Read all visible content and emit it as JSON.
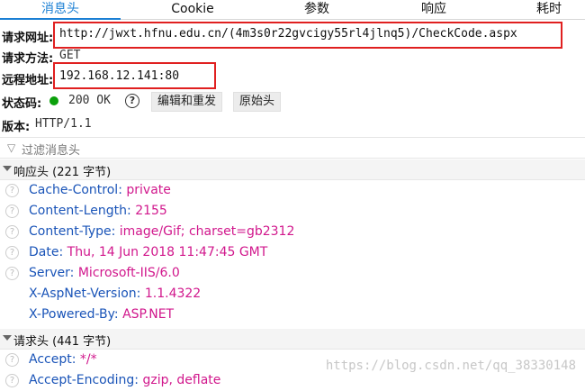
{
  "tabs": [
    "消息头",
    "Cookie",
    "参数",
    "响应",
    "耗时"
  ],
  "request_url": {
    "label": "请求网址:",
    "value": "http://jwxt.hfnu.edu.cn/(4m3s0r22gvcigy55rl4jlnq5)/CheckCode.aspx"
  },
  "request_method": {
    "label": "请求方法:",
    "value": "GET"
  },
  "remote_address": {
    "label": "远程地址:",
    "value": "192.168.12.141:80"
  },
  "status": {
    "label": "状态码:",
    "value": "200 OK",
    "help": "?",
    "edit_resend": "编辑和重发",
    "raw_headers": "原始头",
    "color": "#0ba00b"
  },
  "version": {
    "label": "版本:",
    "value": "HTTP/1.1"
  },
  "filter": {
    "placeholder": "过滤消息头",
    "icon": "filter-icon"
  },
  "response_section": {
    "title": "响应头 (221 字节)"
  },
  "response_headers": [
    {
      "name": "Cache-Control:",
      "value": "private",
      "help": true
    },
    {
      "name": "Content-Length:",
      "value": "2155",
      "help": true
    },
    {
      "name": "Content-Type:",
      "value": "image/Gif; charset=gb2312",
      "help": true
    },
    {
      "name": "Date:",
      "value": "Thu, 14 Jun 2018 11:47:45 GMT",
      "help": true
    },
    {
      "name": "Server:",
      "value": "Microsoft-IIS/6.0",
      "help": true
    },
    {
      "name": "X-AspNet-Version:",
      "value": "1.1.4322",
      "help": false
    },
    {
      "name": "X-Powered-By:",
      "value": "ASP.NET",
      "help": false
    }
  ],
  "request_section": {
    "title": "请求头 (441 字节)"
  },
  "request_headers": [
    {
      "name": "Accept:",
      "value": "*/*",
      "help": true
    },
    {
      "name": "Accept-Encoding:",
      "value": "gzip, deflate",
      "help": true
    }
  ],
  "watermark": "https://blog.csdn.net/qq_38330148",
  "colors": {
    "accent": "#1a7fd4",
    "highlight": "#e02020",
    "header_name": "#1a54b8",
    "header_value": "#d1178c"
  }
}
